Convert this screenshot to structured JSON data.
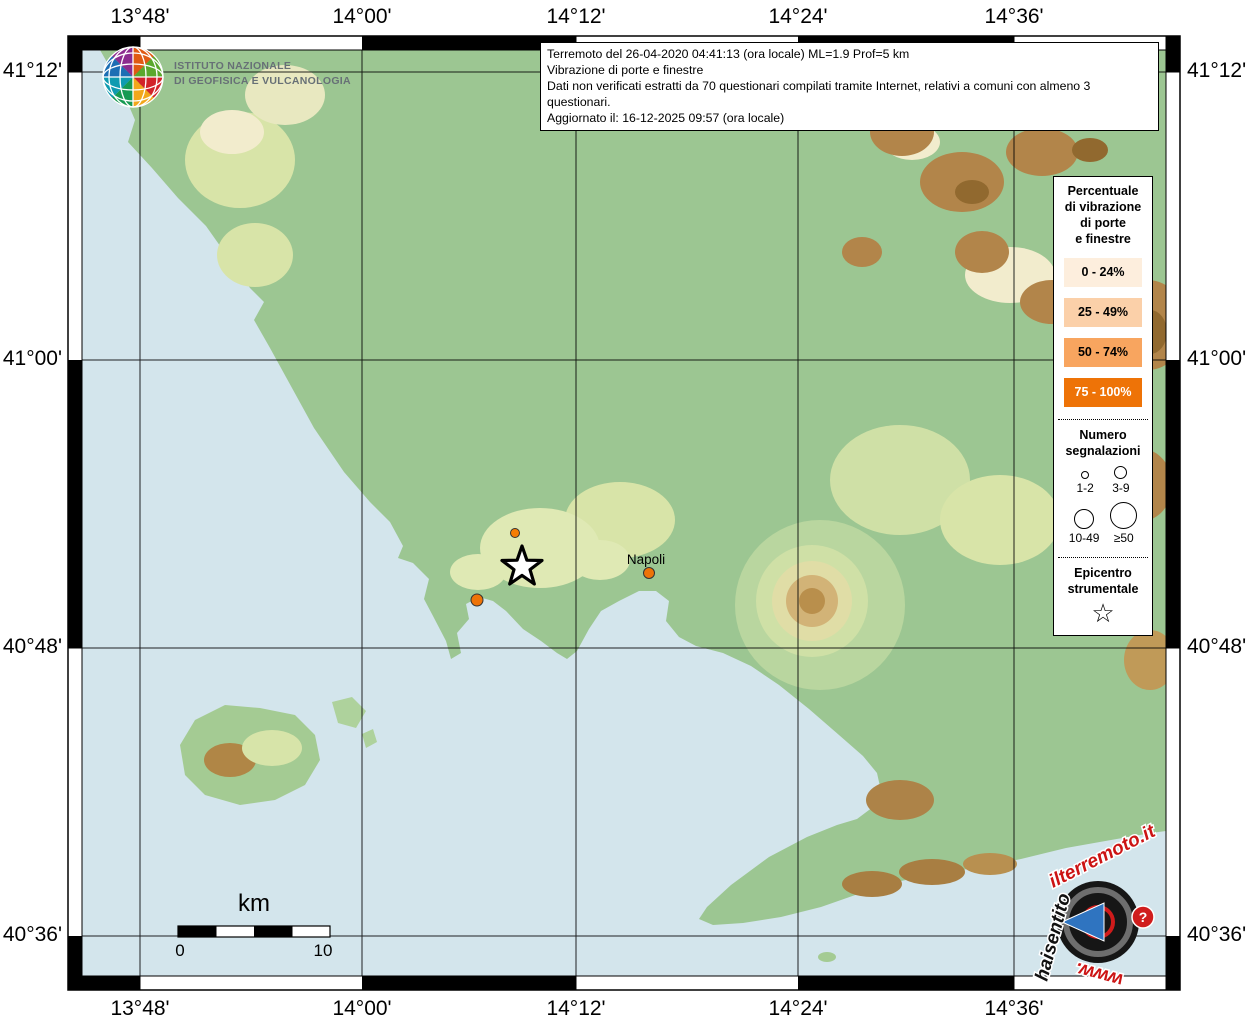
{
  "axes": {
    "top": [
      "13°48'",
      "14°00'",
      "14°12'",
      "14°24'",
      "14°36'"
    ],
    "bottom": [
      "13°48'",
      "14°00'",
      "14°12'",
      "14°24'",
      "14°36'"
    ],
    "left": [
      "41°12'",
      "41°00'",
      "40°48'",
      "40°36'"
    ],
    "right": [
      "41°12'",
      "41°00'",
      "40°48'",
      "40°36'"
    ]
  },
  "logo": {
    "line1": "ISTITUTO NAZIONALE",
    "line2": "DI GEOFISICA E VULCANOLOGIA"
  },
  "info_box": {
    "line1": "Terremoto del 26-04-2020 04:41:13 (ora locale) ML=1.9 Prof=5 km",
    "line2": "Vibrazione di porte e finestre",
    "line3": "Dati non verificati estratti da 70 questionari compilati tramite Internet, relativi a comuni con almeno 3 questionari.",
    "line4": "Aggiornato il: 16-12-2025 09:57 (ora locale)"
  },
  "legend": {
    "title_lines": [
      "Percentuale",
      "di vibrazione",
      "di porte",
      "e finestre"
    ],
    "classes": [
      {
        "label": "0 - 24%",
        "color": "#fdeedd",
        "text_color": "#000000"
      },
      {
        "label": "25 - 49%",
        "color": "#fbd0a9",
        "text_color": "#000000"
      },
      {
        "label": "50 - 74%",
        "color": "#f8a55f",
        "text_color": "#000000"
      },
      {
        "label": "75 - 100%",
        "color": "#ee7307",
        "text_color": "#ffffff"
      }
    ],
    "counts": {
      "title_lines": [
        "Numero",
        "segnalazioni"
      ],
      "sizes": [
        {
          "label": "1-2"
        },
        {
          "label": "3-9"
        },
        {
          "label": "10-49"
        },
        {
          "label": "≥50"
        }
      ]
    },
    "epicenter": {
      "title_lines": [
        "Epicentro",
        "strumentale"
      ],
      "icon": "☆"
    }
  },
  "map_labels": {
    "napoli": "Napoli"
  },
  "scale_bar": {
    "unit": "km",
    "start": "0",
    "end": "10"
  },
  "watermark": {
    "www": "www.",
    "mid": "haisentito",
    "top": "ilterremoto.it",
    "question": "?"
  }
}
